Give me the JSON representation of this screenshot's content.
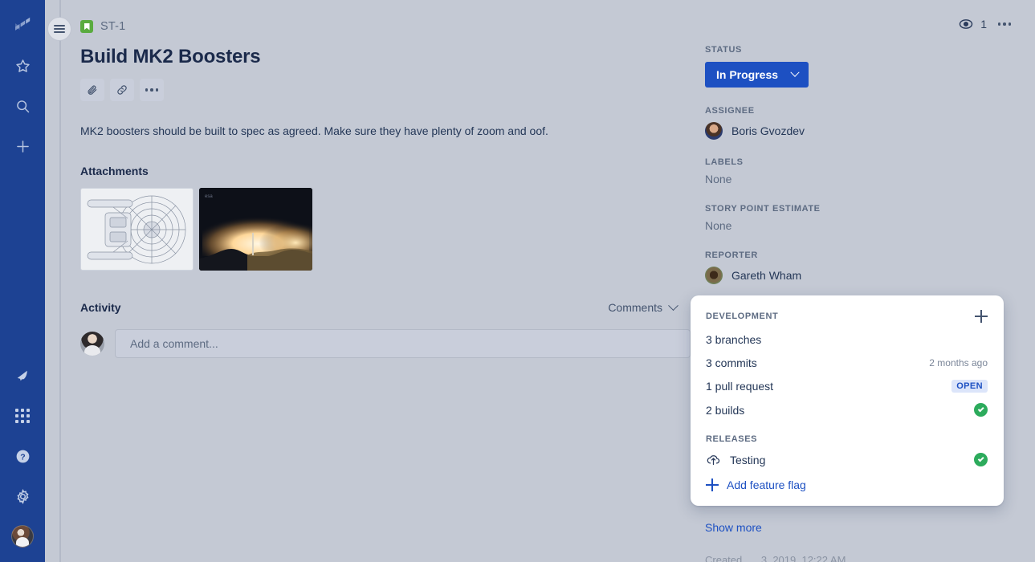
{
  "global_nav": {
    "top_items": [
      {
        "name": "jira-logo",
        "label": "Jira"
      },
      {
        "name": "starred-icon",
        "label": "Starred"
      },
      {
        "name": "search-icon",
        "label": "Search"
      },
      {
        "name": "create-icon",
        "label": "Create"
      }
    ],
    "bottom_items": [
      {
        "name": "notifications-icon",
        "label": "Notifications"
      },
      {
        "name": "app-switcher-icon",
        "label": "App switcher"
      },
      {
        "name": "help-icon",
        "label": "Help"
      },
      {
        "name": "settings-icon",
        "label": "Settings"
      },
      {
        "name": "profile-avatar",
        "label": "Your profile"
      }
    ],
    "background": "#1d4293"
  },
  "nav_toggle": {
    "label": "Expand sidebar"
  },
  "issue": {
    "key": "ST-1",
    "type": "Story",
    "title": "Build MK2 Boosters",
    "description": "MK2 boosters should be built to spec as agreed. Make sure they have plenty of zoom and oof.",
    "actions": [
      {
        "name": "attach-button",
        "label": "Attach"
      },
      {
        "name": "link-button",
        "label": "Link issue"
      },
      {
        "name": "more-actions-button",
        "label": "More"
      }
    ]
  },
  "attachments": {
    "heading": "Attachments",
    "items": [
      {
        "name": "attachment-blueprint",
        "label": "Starship blueprint"
      },
      {
        "name": "attachment-launch",
        "label": "Rocket launch photo"
      }
    ]
  },
  "activity": {
    "heading": "Activity",
    "filter_selected": "Comments",
    "comment_placeholder": "Add a comment..."
  },
  "header_right": {
    "watch_count": "1",
    "watch_label": "Watch",
    "more_label": "More actions"
  },
  "details": {
    "status": {
      "label": "STATUS",
      "value": "In Progress",
      "color": "#1d50c2"
    },
    "assignee": {
      "label": "ASSIGNEE",
      "value": "Boris Gvozdev"
    },
    "labels": {
      "label": "LABELS",
      "value": "None"
    },
    "story_points": {
      "label": "STORY POINT ESTIMATE",
      "value": "None"
    },
    "reporter": {
      "label": "REPORTER",
      "value": "Gareth Wham"
    },
    "show_more": "Show more"
  },
  "development": {
    "heading": "DEVELOPMENT",
    "add_label": "Add",
    "rows": [
      {
        "label": "3 branches",
        "meta": "",
        "badge": "",
        "status": ""
      },
      {
        "label": "3 commits",
        "meta": "2 months ago",
        "badge": "",
        "status": ""
      },
      {
        "label": "1 pull request",
        "meta": "",
        "badge": "OPEN",
        "status": ""
      },
      {
        "label": "2 builds",
        "meta": "",
        "badge": "",
        "status": "success"
      }
    ],
    "releases": {
      "heading": "RELEASES",
      "name": "Testing",
      "status": "success"
    },
    "feature_flag_label": "Add feature flag"
  },
  "footer": {
    "created_label": "Created",
    "created_value": "3, 2019, 12:22 AM"
  },
  "colors": {
    "page_bg": "#c4c9d4",
    "nav_bg": "#1d4293",
    "accent": "#1d50c2",
    "success": "#2cab5c",
    "story_icon": "#5aab3f"
  }
}
